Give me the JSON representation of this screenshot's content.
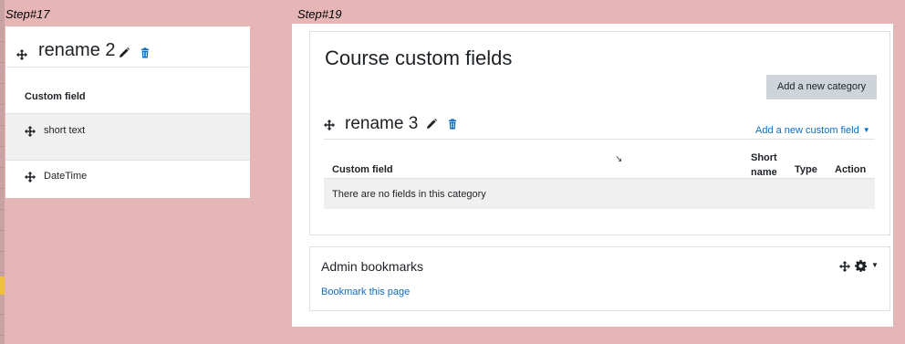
{
  "labels": {
    "step_left": "Step#17",
    "step_right": "Step#19"
  },
  "left_panel": {
    "category_title": "rename 2",
    "column_header": "Custom field",
    "fields": [
      {
        "label": "short text"
      },
      {
        "label": "DateTime"
      }
    ]
  },
  "right_panel": {
    "heading": "Course custom fields",
    "add_category_button": "Add a new category",
    "category_title": "rename 3",
    "add_field_link": "Add a new custom field",
    "columns": {
      "custom_field": "Custom field",
      "short_name_line1": "Short",
      "short_name_line2": "name",
      "type": "Type",
      "action": "Action"
    },
    "empty_message": "There are no fields in this category"
  },
  "bookmarks_block": {
    "title": "Admin bookmarks",
    "link": "Bookmark this page"
  },
  "colors": {
    "background": "#e6b6b6",
    "link": "#0f6cbf",
    "button_bg": "#ced4da",
    "row_shade": "#f0f0f0"
  },
  "icons": [
    "move-icon",
    "edit-icon",
    "trash-icon",
    "gear-icon",
    "caret-down-icon"
  ]
}
